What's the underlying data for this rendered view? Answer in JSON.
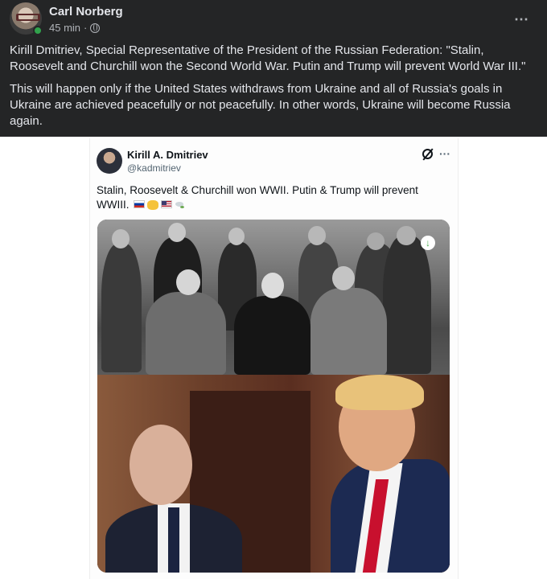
{
  "post": {
    "author": "Carl Norberg",
    "time": "45 min",
    "separator": "·",
    "paragraphs": [
      "Kirill Dmitriev, Special Representative of the President of the Russian Federation: \"Stalin, Roosevelt and Churchill won the Second World War. Putin and Trump will prevent World War III.\"",
      "This will happen only if the United States withdraws from Ukraine and all of Russia's goals in Ukraine are achieved peacefully or not peacefully. In other words, Ukraine will become Russia again."
    ],
    "more_icon": "⋯",
    "colors": {
      "background": "#242526",
      "online": "#31a24c"
    }
  },
  "tweet": {
    "name": "Kirill A. Dmitriev",
    "handle": "@kadmitriev",
    "text": "Stalin, Roosevelt & Churchill won WWII. Putin & Trump will prevent WWIII.",
    "more_icon": "···",
    "download_icon": "↓",
    "emojis": [
      "flag-russia",
      "handshake",
      "flag-usa",
      "dove"
    ]
  }
}
